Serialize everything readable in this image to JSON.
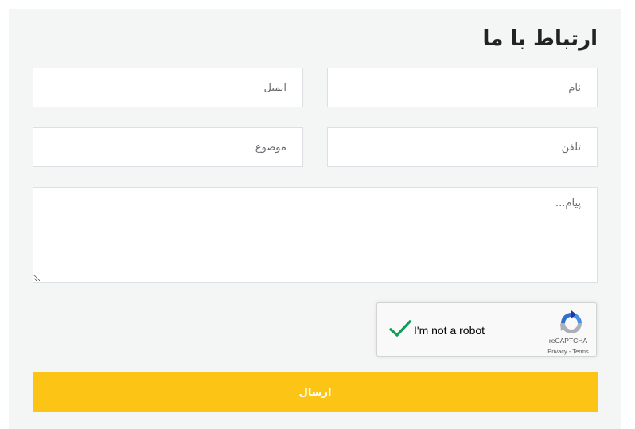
{
  "form": {
    "title": "ارتباط با ما",
    "name_placeholder": "نام",
    "email_placeholder": "ایمیل",
    "phone_placeholder": "تلفن",
    "subject_placeholder": "موضوع",
    "message_placeholder": "پیام...",
    "submit_label": "ارسال"
  },
  "recaptcha": {
    "label": "I'm not a robot",
    "brand": "reCAPTCHA",
    "privacy": "Privacy",
    "separator": " - ",
    "terms": "Terms",
    "checked": true,
    "check_color": "#0f9d58"
  },
  "colors": {
    "panel_background": "#f4f5f5",
    "submit_background": "#fcc516",
    "submit_text": "#ffffff"
  }
}
